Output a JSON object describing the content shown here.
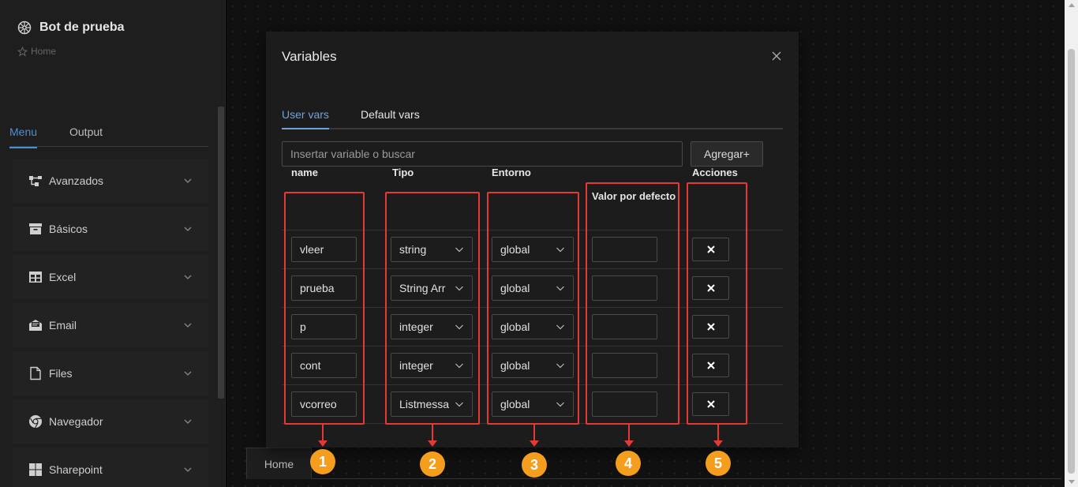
{
  "app": {
    "title": "Bot de prueba",
    "breadcrumb": "Home"
  },
  "sidebar": {
    "tabs": [
      "Menu",
      "Output"
    ],
    "items": [
      {
        "label": "Avanzados",
        "icon": "flow-icon"
      },
      {
        "label": "Básicos",
        "icon": "archive-icon"
      },
      {
        "label": "Excel",
        "icon": "table-icon"
      },
      {
        "label": "Email",
        "icon": "email-icon"
      },
      {
        "label": "Files",
        "icon": "file-icon"
      },
      {
        "label": "Navegador",
        "icon": "chrome-icon"
      },
      {
        "label": "Sharepoint",
        "icon": "windows-icon"
      }
    ]
  },
  "bottom_tab": {
    "label": "Home"
  },
  "modal": {
    "title": "Variables",
    "tabs": [
      "User vars",
      "Default vars"
    ],
    "search_placeholder": "Insertar variable o buscar",
    "add_label": "Agregar+",
    "headers": [
      "name",
      "Tipo",
      "Entorno",
      "Valor por defecto",
      "Acciones"
    ],
    "rows": [
      {
        "name": "vleer",
        "tipo": "string",
        "entorno": "global",
        "valor": ""
      },
      {
        "name": "prueba",
        "tipo": "String Arr",
        "entorno": "global",
        "valor": ""
      },
      {
        "name": "p",
        "tipo": "integer",
        "entorno": "global",
        "valor": ""
      },
      {
        "name": "cont",
        "tipo": "integer",
        "entorno": "global",
        "valor": ""
      },
      {
        "name": "vcorreo",
        "tipo": "Listmessa",
        "entorno": "global",
        "valor": ""
      }
    ]
  },
  "annotations": [
    "1",
    "2",
    "3",
    "4",
    "5"
  ],
  "colors": {
    "accent": "#4a90d9",
    "callout": "#e53935",
    "badge": "#f59d1c"
  }
}
